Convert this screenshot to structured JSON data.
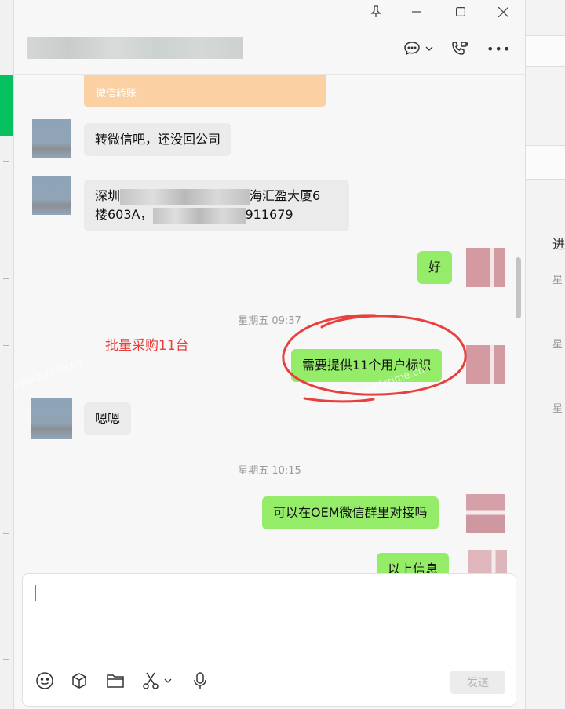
{
  "side_panel": {
    "item_text": "进",
    "labels": [
      "星",
      "星",
      "星"
    ]
  },
  "window": {
    "title": "",
    "buttons": {
      "pin": "pin-icon",
      "minimize": "minimize-icon",
      "maximize": "maximize-icon",
      "close": "close-icon"
    }
  },
  "header": {
    "icons": [
      "chat-icon",
      "video-call-icon",
      "more-icon"
    ],
    "more_glyph": "•••"
  },
  "messages": {
    "transfer_label": "微信转账",
    "m1": "转微信吧，还没回公司",
    "m2_a": "深圳",
    "m2_b": "海汇盈大厦6",
    "m2_c": "楼603A，",
    "m2_d": "911679",
    "m3": "好",
    "ts1": "星期五 09:37",
    "m4": "需要提供11个用户标识",
    "m5": "嗯嗯",
    "ts2": "星期五 10:15",
    "m6": "可以在OEM微信群里对接吗",
    "m7": "以上信息"
  },
  "annotation": {
    "text": "批量采购11台",
    "color": "#e8403c"
  },
  "watermarks": [
    "www.fctime.cn",
    "www.fctime.cn"
  ],
  "input": {
    "value": "",
    "send_label": "发送",
    "tools": [
      "emoji-icon",
      "box-icon",
      "folder-icon",
      "scissors-icon",
      "microphone-icon"
    ]
  },
  "colors": {
    "accent": "#07c160",
    "outgoing_bubble": "#95ec69",
    "incoming_bubble": "#ebebeb"
  }
}
